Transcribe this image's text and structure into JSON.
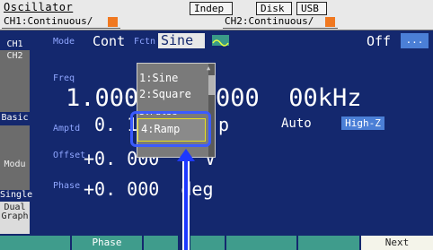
{
  "header": {
    "title": "Oscillator",
    "mode_indep": "Indep",
    "disk": "Disk",
    "usb": "USB",
    "ch1_status": "CH1:Continuous/",
    "ch2_status": "CH2:Continuous/"
  },
  "sidebar": {
    "ch1": "CH1",
    "ch2": "CH2",
    "basic": "Basic",
    "modu": "Modu",
    "single": "Single",
    "dual": "Dual",
    "graph": "Graph"
  },
  "main": {
    "mode_label": "Mode",
    "mode_value": "Cont",
    "fctn_label": "Fctn",
    "fctn_value": "Sine",
    "output_state": "Off",
    "output_btn": "...",
    "freq_label": "Freq",
    "freq_value_left": "1.000",
    "freq_value_right": "000  00kHz",
    "amptd_label": "Amptd",
    "amptd_value": "0. 1",
    "amptd_unit": "p",
    "auto_label": "Auto",
    "highz_btn": "High-Z",
    "offset_label": "Offset",
    "offset_value": "+0. 000",
    "offset_unit": "V",
    "phase_label": "Phase",
    "phase_value": "+0. 000  deg"
  },
  "dropdown": {
    "items": [
      "1:Sine",
      "2:Square",
      "3:Pulse",
      "4:Ramp"
    ],
    "selected": "4:Ramp"
  },
  "softkeys": {
    "k1": "",
    "k2": "Phase",
    "k3": "",
    "k4": "",
    "k5": "",
    "k6": "",
    "next": "Next"
  },
  "colors": {
    "background": "#14286e",
    "accent_orange": "#f07820",
    "softkey": "#3f9c8c",
    "highlight": "#3b5bff"
  }
}
